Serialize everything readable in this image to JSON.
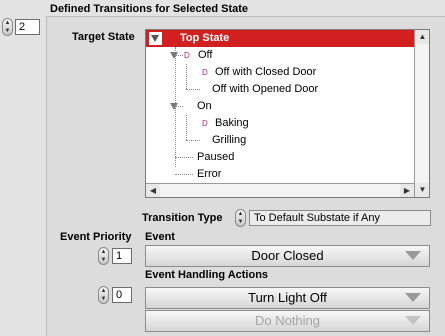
{
  "section_title": "Defined Transitions for Selected State",
  "transition_index": "2",
  "target_state_label": "Target State",
  "tree_items": [
    {
      "label": "Top State",
      "selected": true
    },
    {
      "label": "Off"
    },
    {
      "label": "Off with Closed Door"
    },
    {
      "label": "Off with Opened Door"
    },
    {
      "label": "On"
    },
    {
      "label": "Baking"
    },
    {
      "label": "Grilling"
    },
    {
      "label": "Paused"
    },
    {
      "label": "Error"
    }
  ],
  "transition_type_label": "Transition Type",
  "transition_type_value": "To Default Substate if Any",
  "event_priority_label": "Event Priority",
  "event_label": "Event",
  "event_priority_value": "1",
  "event_value": "Door Closed",
  "event_handling_label": "Event Handling Actions",
  "action_index": "0",
  "actions": [
    "Turn Light Off",
    "Do Nothing"
  ],
  "colors": {
    "selection": "#d21f1f",
    "marker": "#c0208c"
  }
}
